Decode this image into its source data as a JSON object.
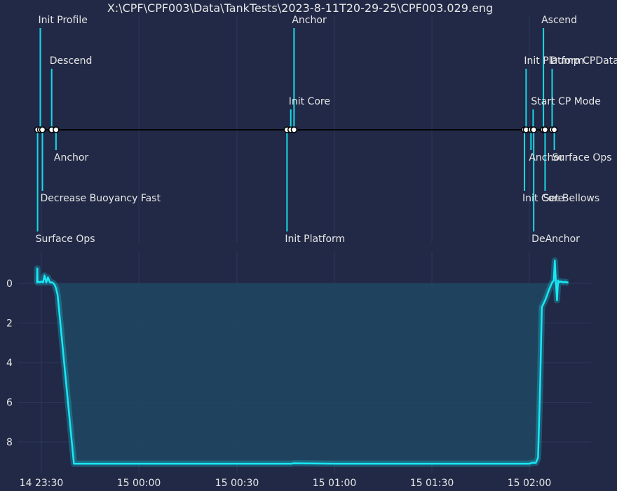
{
  "title": "X:\\CPF\\CPF003\\Data\\TankTests\\2023-8-11T20-29-25\\CPF003.029.eng",
  "colors": {
    "background": "#212946",
    "grid": "#2d375a",
    "accent": "#18e8f6",
    "stem": "#18d8e8",
    "baseline": "#000000",
    "text": "#e6e6e6",
    "fill": "#1f4863"
  },
  "chart_data": [
    {
      "type": "timeline",
      "events": [
        {
          "time": "23:28:50",
          "label": "Surface Ops",
          "level": -5
        },
        {
          "time": "23:29:40",
          "label": "Init Profile",
          "level": 5
        },
        {
          "time": "23:30:20",
          "label": "Decrease Buoyancy Fast",
          "level": -3
        },
        {
          "time": "23:33:10",
          "label": "Descend",
          "level": 3
        },
        {
          "time": "23:34:30",
          "label": "Anchor",
          "level": -1
        },
        {
          "time": "00:45:30",
          "label": "Init Platform",
          "level": -5
        },
        {
          "time": "00:46:40",
          "label": "Init Core",
          "level": 1
        },
        {
          "time": "00:47:40",
          "label": "Anchor",
          "level": 5
        },
        {
          "time": "01:58:30",
          "label": "Init Core",
          "level": -3
        },
        {
          "time": "01:59:00",
          "label": "Init Platform",
          "level": 3
        },
        {
          "time": "02:00:30",
          "label": "Anchor",
          "level": -1
        },
        {
          "time": "02:01:10",
          "label": "Start CP Mode",
          "level": 1
        },
        {
          "time": "02:01:20",
          "label": "DeAnchor",
          "level": -5
        },
        {
          "time": "02:04:20",
          "label": "Ascend",
          "level": 5
        },
        {
          "time": "02:04:50",
          "label": "Set Bellows",
          "level": -3
        },
        {
          "time": "02:07:00",
          "label": "Dump CPData",
          "level": 3
        },
        {
          "time": "02:07:40",
          "label": "Surface Ops",
          "level": -1
        }
      ]
    },
    {
      "type": "area",
      "x_ticks": [
        "14 23:30",
        "15 00:00",
        "15 00:30",
        "15 01:00",
        "15 01:30",
        "15 02:00"
      ],
      "y_ticks": [
        "0",
        "2",
        "4",
        "6",
        "8"
      ],
      "ylim": [
        9.5,
        -0.8
      ],
      "grid": true,
      "x": [
        "23:28:30",
        "23:28:40",
        "23:28:45",
        "23:28:50",
        "23:29:00",
        "23:29:30",
        "23:30:00",
        "23:30:30",
        "23:31:00",
        "23:31:30",
        "23:32:00",
        "23:32:40",
        "23:33:20",
        "23:33:50",
        "23:34:10",
        "23:34:30",
        "23:35:00",
        "23:40:00",
        "00:00:00",
        "00:30:00",
        "00:45:00",
        "00:47:00",
        "00:47:30",
        "01:00:00",
        "01:30:00",
        "01:58:00",
        "02:00:00",
        "02:01:00",
        "02:02:00",
        "02:02:40",
        "02:03:00",
        "02:03:20",
        "02:03:50",
        "02:05:00",
        "02:06:00",
        "02:07:00",
        "02:07:30",
        "02:07:50",
        "02:08:10",
        "02:08:30",
        "02:08:50",
        "02:09:10",
        "02:09:40",
        "02:10:30",
        "02:11:00",
        "02:11:30",
        "02:12:00"
      ],
      "values": [
        -0.05,
        -0.05,
        -0.75,
        -0.05,
        -0.1,
        -0.05,
        -0.1,
        -0.05,
        -0.4,
        -0.05,
        -0.3,
        -0.05,
        -0.05,
        0.02,
        0.1,
        0.25,
        0.6,
        9.1,
        9.1,
        9.1,
        9.1,
        9.1,
        9.08,
        9.1,
        9.1,
        9.1,
        9.1,
        9.05,
        9.05,
        8.8,
        7.0,
        5.0,
        1.2,
        0.8,
        0.35,
        -0.05,
        -0.15,
        -1.15,
        -0.05,
        0.85,
        -0.15,
        -0.05,
        -0.1,
        -0.05,
        -0.08,
        -0.05,
        -0.05
      ]
    }
  ]
}
